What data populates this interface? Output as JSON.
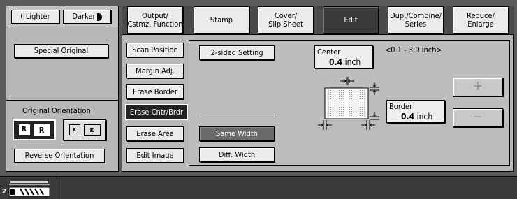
{
  "density": {
    "lighter": "Lighter",
    "darker": "Darker"
  },
  "left": {
    "special_original": "Special Original",
    "orientation_label": "Original Orientation",
    "reverse_orientation": "Reverse Orientation"
  },
  "tabs": [
    {
      "line1": "Output/",
      "line2": "Cstmz. Function"
    },
    {
      "line1": "Stamp",
      "line2": ""
    },
    {
      "line1": "Cover/",
      "line2": "Slip Sheet"
    },
    {
      "line1": "Edit",
      "line2": ""
    },
    {
      "line1": "Dup./Combine/",
      "line2": "Series"
    },
    {
      "line1": "Reduce/",
      "line2": "Enlarge"
    }
  ],
  "edit_menu": [
    "Scan Position",
    "Margin Adj.",
    "Erase Border",
    "Erase Cntr/Brdr",
    "Erase Area",
    "Edit Image"
  ],
  "two_sided": "2-sided Setting",
  "same_width": "Same Width",
  "diff_width": "Diff. Width",
  "center": {
    "label": "Center",
    "value": "0.4",
    "unit": "inch"
  },
  "range": "<0.1 - 3.9 inch>",
  "border": {
    "label": "Border",
    "value": "0.4",
    "unit": "inch"
  },
  "plus": "+",
  "minus": "−",
  "status": {
    "counter": "2"
  }
}
